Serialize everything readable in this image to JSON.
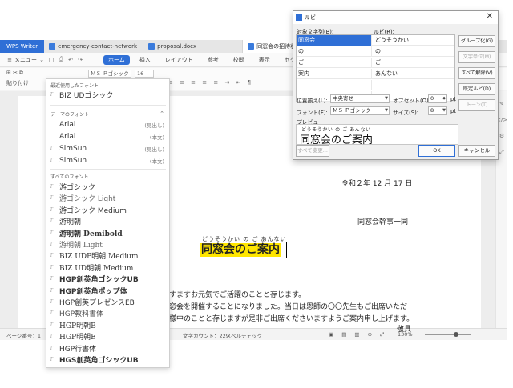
{
  "app": {
    "name": "WPS Writer",
    "tabs": [
      {
        "label": "emergency-contact-network"
      },
      {
        "label": "proposal.docx"
      },
      {
        "label": "同窓会の招待状.docx"
      }
    ]
  },
  "menu": {
    "menu_label": "メニュー",
    "ribbon_tabs": [
      "ホーム",
      "挿入",
      "レイアウト",
      "参考",
      "校閲",
      "表示",
      "セクション"
    ]
  },
  "toolbar": {
    "paste_label": "貼り付け",
    "copy_format_label": "書式のコピー/貼り付け",
    "font_name": "ＭＳ Ｐゴシック",
    "font_size": "16"
  },
  "font_dropdown": {
    "recent_header": "最近使用したフォント",
    "recent": [
      {
        "name": "BIZ UDゴシック"
      }
    ],
    "theme_header": "テーマのフォント",
    "theme": [
      {
        "name": "Arial",
        "tag": "(見出し)"
      },
      {
        "name": "Arial",
        "tag": "(本文)"
      },
      {
        "name": "SimSun",
        "tag": "(見出し)"
      },
      {
        "name": "SimSun",
        "tag": "(本文)"
      }
    ],
    "all_header": "すべてのフォント",
    "all": [
      {
        "name": "游ゴシック"
      },
      {
        "name": "游ゴシック Light"
      },
      {
        "name": "游ゴシック Medium"
      },
      {
        "name": "游明朝"
      },
      {
        "name": "游明朝 Demibold"
      },
      {
        "name": "游明朝 Light"
      },
      {
        "name": "BIZ UDP明朝 Medium"
      },
      {
        "name": "BIZ UD明朝 Medium"
      },
      {
        "name": "HGP創英角ゴシックUB"
      },
      {
        "name": "HGP創英角ポップ体"
      },
      {
        "name": "HGP創英プレゼンスEB"
      },
      {
        "name": "HGP教科書体"
      },
      {
        "name": "HGP明朝B"
      },
      {
        "name": "HGP明朝E"
      },
      {
        "name": "HGP行書体"
      },
      {
        "name": "HGS創英角ゴシックUB"
      }
    ]
  },
  "document": {
    "date": "令和２年 12 月 17 日",
    "sender": "同窓会幹事一同",
    "title_ruby": "どうそうかい の ご あんない",
    "title": "同窓会のご案内",
    "lines": [
      "すますお元気でご活躍のことと存じます。",
      "窓会を開催することになりました。当日は恩師の〇〇先生もご出席いただ",
      "様中のことと存じますが是非ご出席くださいますようご案内申し上げます。"
    ],
    "cut_text": "敬具"
  },
  "status": {
    "page": "ページ番号：1",
    "page_total": "8",
    "word_count": "文字カウント：229",
    "spellcheck": "スペルチェック",
    "zoom": "130%"
  },
  "ruby_dialog": {
    "title": "ルビ",
    "base_header": "対象文字列(B):",
    "ruby_header": "ルビ(R):",
    "rows": [
      {
        "base": "同窓会",
        "ruby": "どうそうかい"
      },
      {
        "base": "の",
        "ruby": "の"
      },
      {
        "base": "ご",
        "ruby": "ご"
      },
      {
        "base": "案内",
        "ruby": "あんない"
      },
      {
        "base": "",
        "ruby": ""
      },
      {
        "base": "",
        "ruby": ""
      }
    ],
    "buttons": {
      "group": "グループ化(G)",
      "char": "文字単位(M)",
      "clear_all": "すべて解除(V)",
      "default": "既定ルビ(D)",
      "tone": "トーン(T)"
    },
    "align_label": "位置揃え(L):",
    "align_value": "中央寄せ",
    "offset_label": "オフセット(O):",
    "offset_value": "0",
    "font_label": "フォント(F):",
    "font_value": "ＭＳ Ｐゴシック",
    "size_label": "サイズ(S):",
    "size_value": "8",
    "unit_pt": "pt",
    "preview_label": "プレビュー",
    "preview_ruby": "どうそうかい の ご あんない",
    "preview_text": "同窓会のご案内",
    "apply_all": "すべて変更...",
    "ok": "OK",
    "cancel": "キャンセル"
  },
  "colors": {
    "accent": "#2f6fd6",
    "highlight": "#ffe600"
  }
}
